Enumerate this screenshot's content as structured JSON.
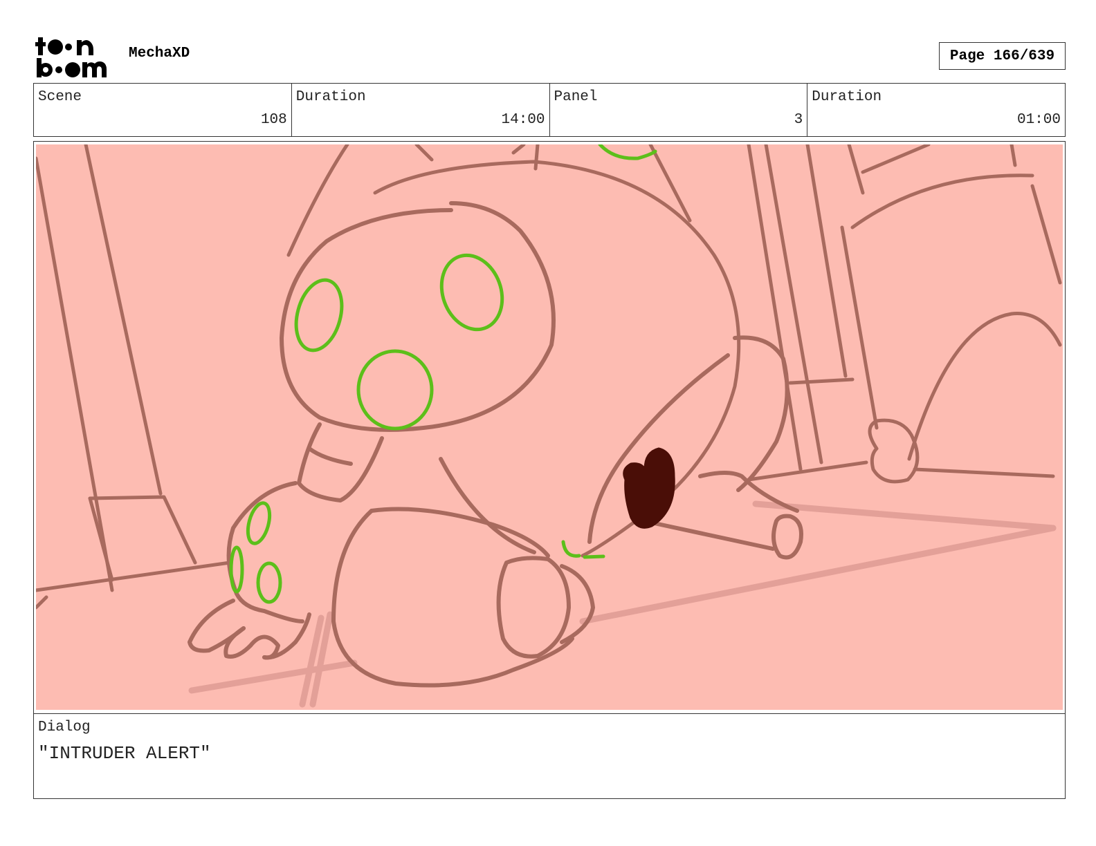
{
  "header": {
    "logo_text": "toonboom",
    "project": "MechaXD",
    "page": "Page 166/639"
  },
  "info": {
    "scene_label": "Scene",
    "scene_value": "108",
    "scene_duration_label": "Duration",
    "scene_duration_value": "14:00",
    "panel_label": "Panel",
    "panel_value": "3",
    "panel_duration_label": "Duration",
    "panel_duration_value": "01:00"
  },
  "panel": {
    "background_color": "#fdbcb2",
    "line_color": "#a86a5e",
    "guide_color": "#5cbf1a",
    "shadow_color": "#e3a098",
    "dark_mark_color": "#4a0e07"
  },
  "dialog": {
    "label": "Dialog",
    "text": "\"INTRUDER ALERT\""
  }
}
